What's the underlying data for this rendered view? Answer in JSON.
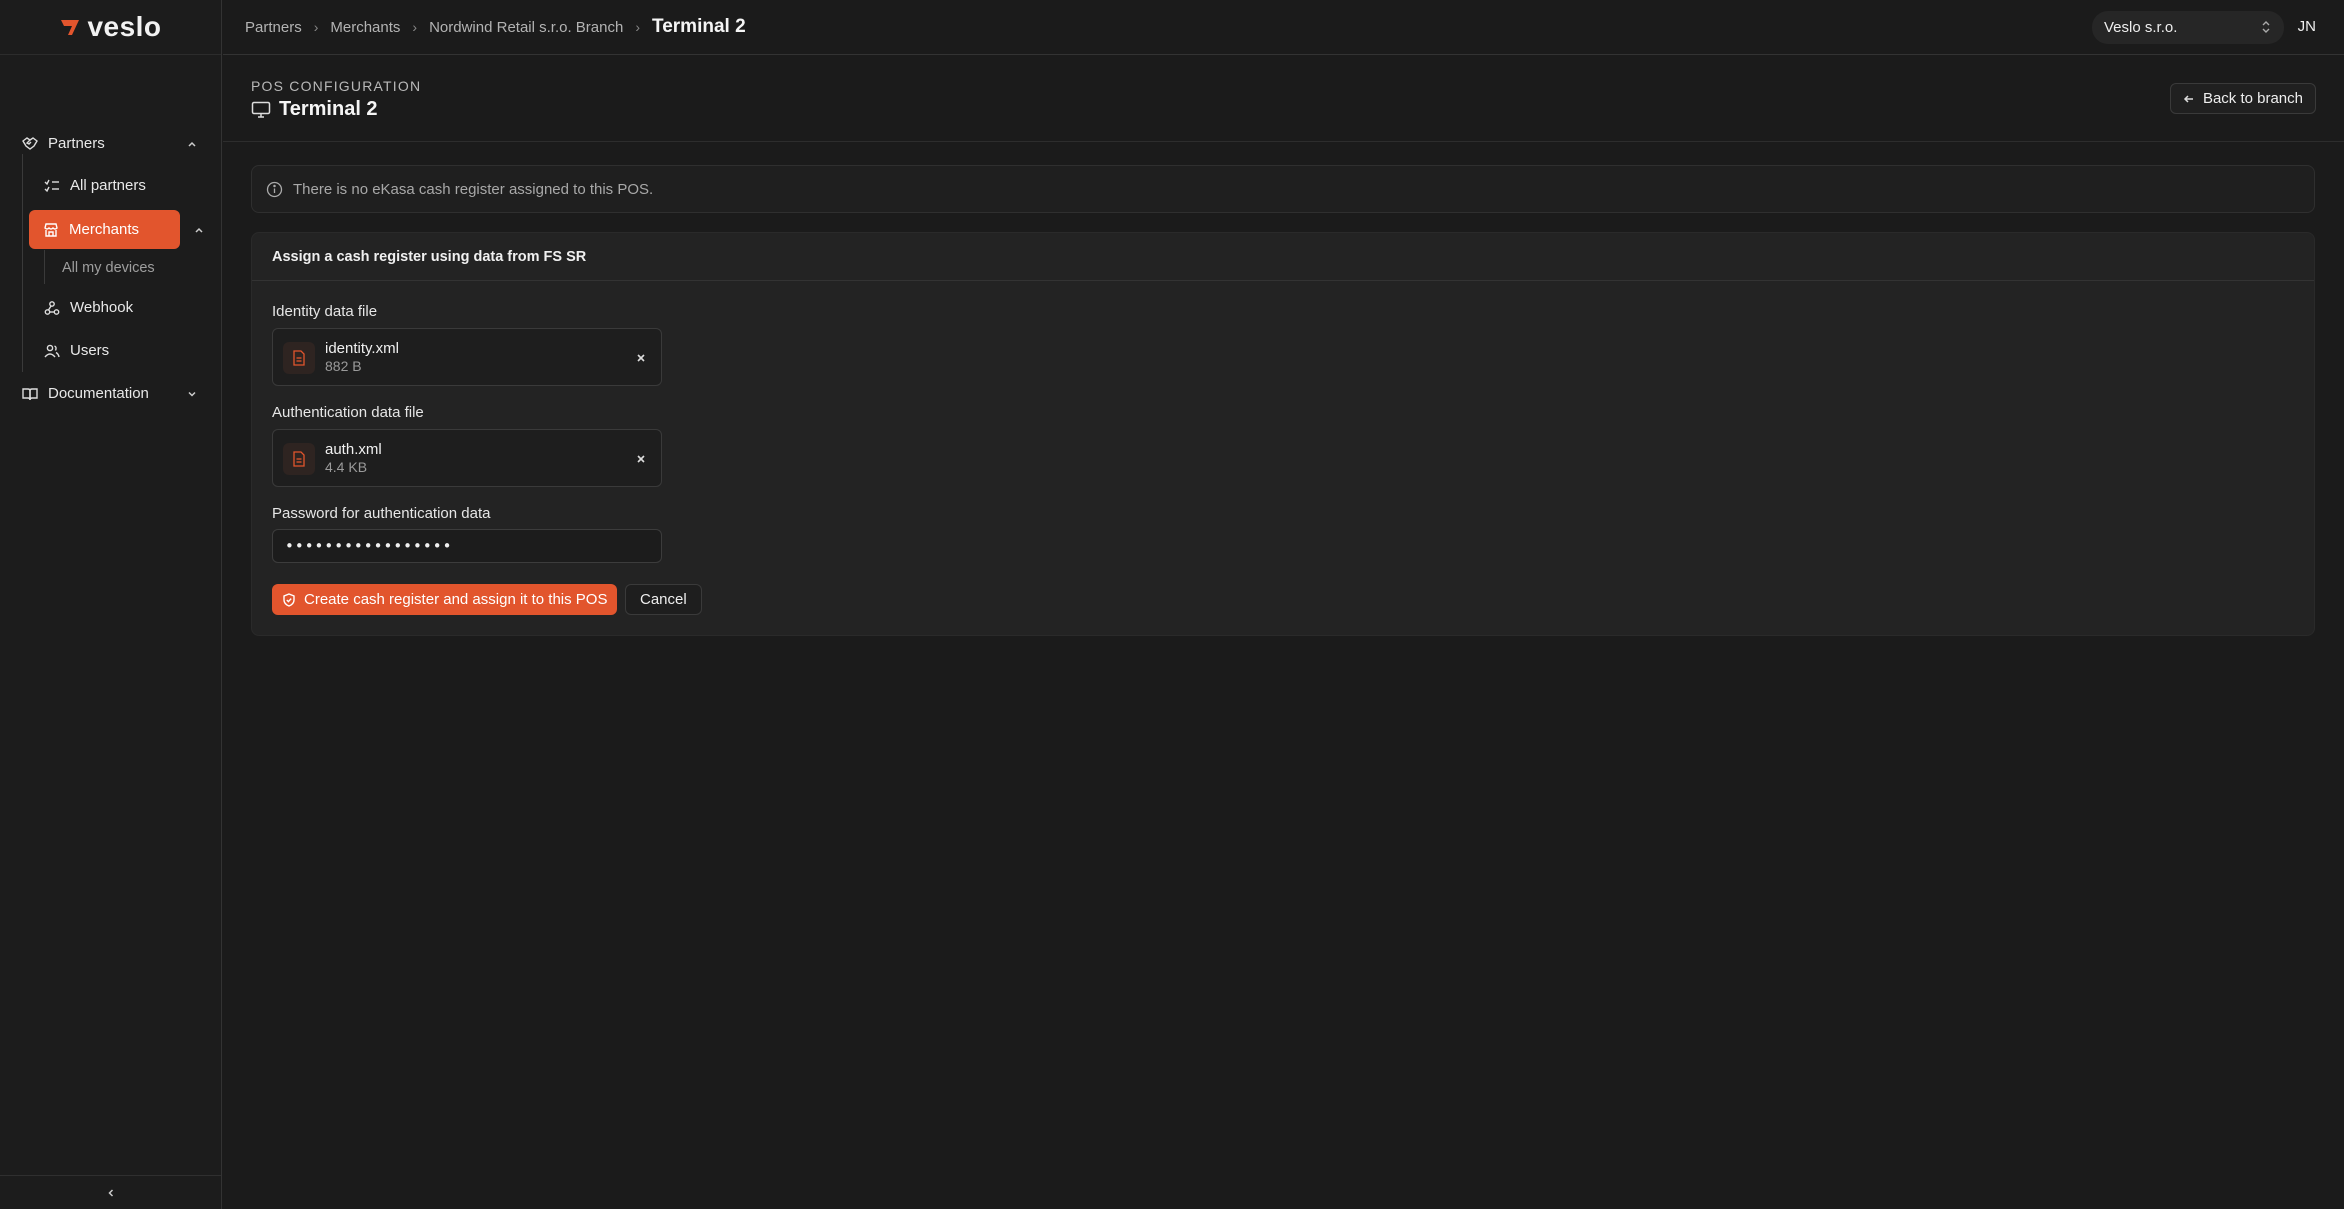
{
  "app": {
    "logo_text": "veslo"
  },
  "sidebar": {
    "partners_label": "Partners",
    "all_partners_label": "All partners",
    "merchants_label": "Merchants",
    "all_my_devices_label": "All my devices",
    "webhook_label": "Webhook",
    "users_label": "Users",
    "documentation_label": "Documentation"
  },
  "breadcrumb": {
    "items": [
      "Partners",
      "Merchants",
      "Nordwind Retail s.r.o. Branch"
    ],
    "current": "Terminal 2"
  },
  "header": {
    "org_select_value": "Veslo s.r.o.",
    "user_initials": "JN"
  },
  "page": {
    "eyebrow": "POS CONFIGURATION",
    "title": "Terminal 2",
    "back_label": "Back to branch"
  },
  "notice": {
    "text": "There is no eKasa cash register assigned to this POS."
  },
  "form": {
    "title": "Assign a cash register using data from FS SR",
    "identity_label": "Identity data file",
    "identity_file": {
      "name": "identity.xml",
      "size": "882 B"
    },
    "auth_label": "Authentication data file",
    "auth_file": {
      "name": "auth.xml",
      "size": "4.4 KB"
    },
    "password_label": "Password for authentication data",
    "password_value": "•••••••••••••••••",
    "submit_label": "Create cash register and assign it to this POS",
    "cancel_label": "Cancel"
  },
  "colors": {
    "accent": "#e2552d",
    "background": "#1b1b1b",
    "card": "#232323"
  }
}
